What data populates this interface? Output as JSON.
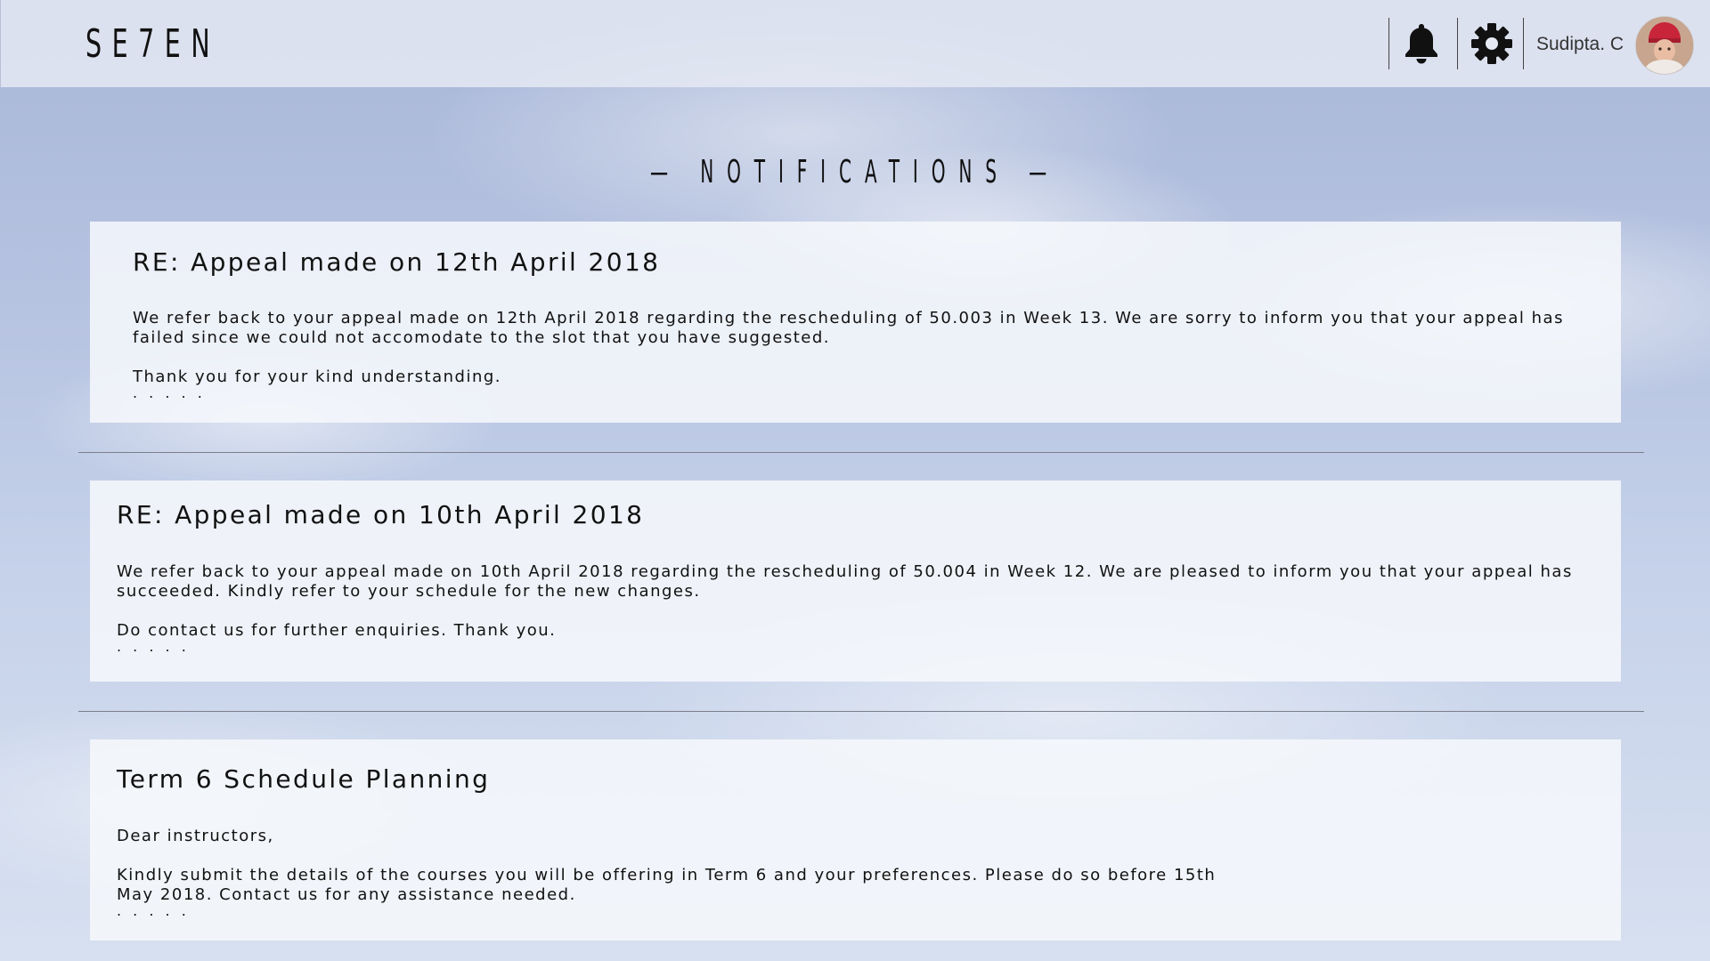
{
  "header": {
    "logo": "SE7EN",
    "user_name": "Sudipta. C"
  },
  "page_title": "— NOTIFICATIONS —",
  "notifications": [
    {
      "title": "RE: Appeal made on 12th April 2018",
      "paragraph1": "We refer back to your appeal made on 12th April 2018 regarding the rescheduling of 50.003 in Week 13. We are sorry to inform you that your appeal has failed since we could not accomodate to the slot that you have suggested.",
      "paragraph2": "Thank you for your kind understanding.",
      "ellipsis": ". . . . ."
    },
    {
      "title": "RE: Appeal made on 10th April 2018",
      "paragraph1": "We refer back to your appeal made on 10th April 2018 regarding the rescheduling of 50.004 in Week 12. We are pleased to inform you that your appeal has succeeded. Kindly refer to your schedule for the new changes.",
      "paragraph2": "Do contact us for further enquiries. Thank you.",
      "ellipsis": ". . . . ."
    },
    {
      "title": "Term 6 Schedule Planning",
      "paragraph1": "Dear instructors,",
      "paragraph2": "Kindly submit the details of the courses you will be offering in Term 6 and your preferences. Please do so before 15th May 2018. Contact us for any assistance needed.",
      "ellipsis": ". . . . ."
    }
  ],
  "icons": {
    "notifications": "bell-icon",
    "settings": "gear-icon"
  }
}
